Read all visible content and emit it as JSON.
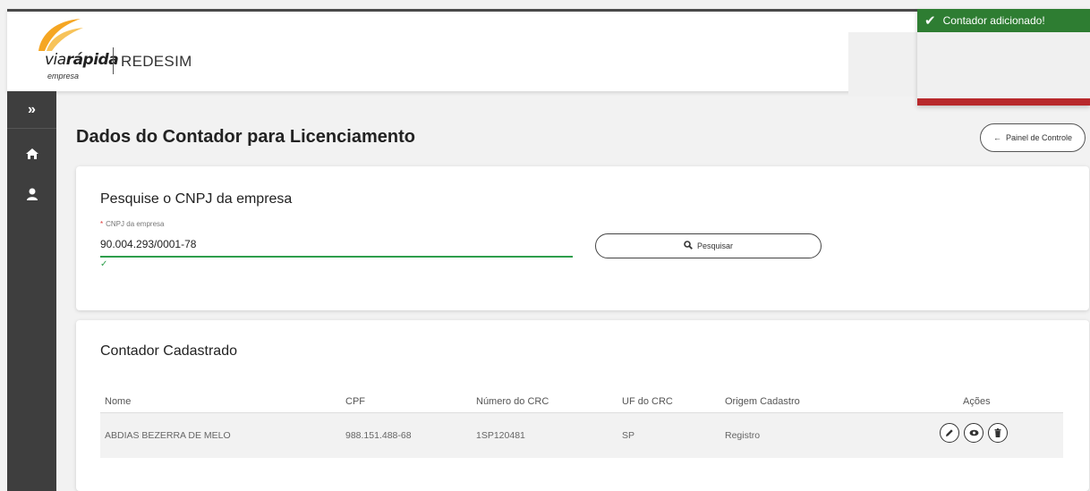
{
  "header": {
    "brand_via": "via",
    "brand_rapida": "rápida",
    "brand_sub": "empresa",
    "product": "REDESIM"
  },
  "toast": {
    "message": "Contador adicionado!",
    "icon": "check-icon"
  },
  "sidebar": {
    "toggle_glyph": "»",
    "items": [
      {
        "name": "home",
        "icon": "home-icon"
      },
      {
        "name": "user",
        "icon": "user-icon"
      }
    ]
  },
  "page": {
    "title": "Dados do Contador para Licenciamento",
    "back_button_label": "Painel de Controle"
  },
  "search": {
    "title": "Pesquise o CNPJ da empresa",
    "field_required_mark": "*",
    "field_label": "CNPJ da empresa",
    "field_value": "90.004.293/0001-78",
    "valid_mark": "✓",
    "button_label": "Pesquisar"
  },
  "table": {
    "title": "Contador Cadastrado",
    "columns": [
      "Nome",
      "CPF",
      "Número do CRC",
      "UF do CRC",
      "Origem Cadastro",
      "Ações"
    ],
    "rows": [
      {
        "nome": "ABDIAS BEZERRA DE MELO",
        "cpf": "988.151.488-68",
        "crc": "1SP120481",
        "uf": "SP",
        "origem": "Registro"
      }
    ]
  },
  "colors": {
    "toast_green": "#2e7d32",
    "toast_red": "#b8292c",
    "valid_green": "#2e9e4c",
    "sidebar": "#3e3e3e",
    "logo_orange": "#f5a623"
  }
}
